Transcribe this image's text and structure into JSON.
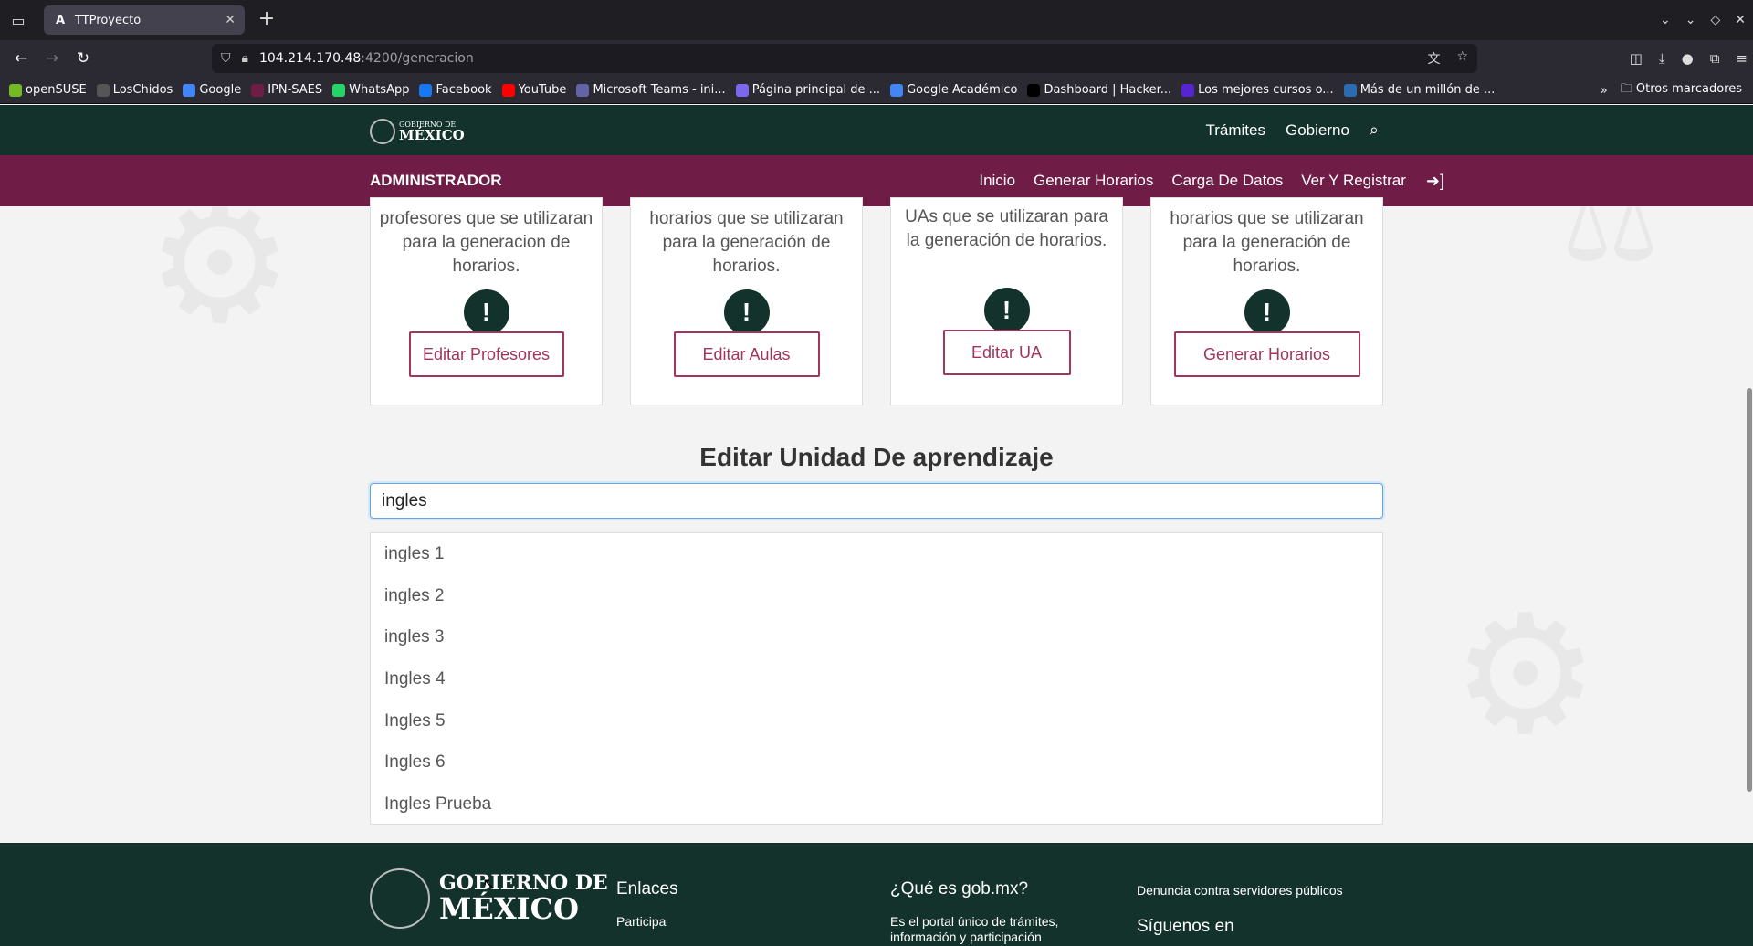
{
  "browser": {
    "tab_title": "TTProyecto",
    "tab_favicon": "A",
    "url_host": "104.214.170.48",
    "url_path": ":4200/generacion",
    "bookmarks": [
      {
        "label": "openSUSE",
        "color": "#73ba25"
      },
      {
        "label": "LosChidos",
        "color": "#555555"
      },
      {
        "label": "Google",
        "color": "#4285f4"
      },
      {
        "label": "IPN-SAES",
        "color": "#6f1d46"
      },
      {
        "label": "WhatsApp",
        "color": "#25d366"
      },
      {
        "label": "Facebook",
        "color": "#1877f2"
      },
      {
        "label": "YouTube",
        "color": "#ff0000"
      },
      {
        "label": "Microsoft Teams - ini...",
        "color": "#6264a7"
      },
      {
        "label": "Página principal de ...",
        "color": "#7b68ee"
      },
      {
        "label": "Google Académico",
        "color": "#4285f4"
      },
      {
        "label": "Dashboard | Hacker...",
        "color": "#000000"
      },
      {
        "label": "Los mejores cursos o...",
        "color": "#5624d0"
      },
      {
        "label": "Más de un millón de ...",
        "color": "#2b6cb0"
      }
    ],
    "other_bookmarks": "Otros marcadores"
  },
  "gob_header": {
    "logo_small": "GOBIERNO DE",
    "logo_big": "MÉXICO",
    "links": [
      "Trámites",
      "Gobierno"
    ]
  },
  "admin_bar": {
    "title": "ADMINISTRADOR",
    "nav": [
      "Inicio",
      "Generar Horarios",
      "Carga De Datos",
      "Ver Y Registrar"
    ]
  },
  "cards": [
    {
      "desc": "profesores que se utilizaran para la generacion de horarios.",
      "button": "Editar Profesores"
    },
    {
      "desc": "horarios que se utilizaran para la generación de horarios.",
      "button": "Editar Aulas"
    },
    {
      "desc": "UAs que se utilizaran para la generación de horarios.",
      "button": "Editar UA"
    },
    {
      "desc": "horarios que se utilizaran para la generación de horarios.",
      "button": "Generar Horarios"
    }
  ],
  "section": {
    "title": "Editar Unidad De aprendizaje",
    "search_value": "ingles",
    "results": [
      "ingles 1",
      "ingles 2",
      "ingles 3",
      "Ingles 4",
      "Ingles 5",
      "Ingles 6",
      "Ingles Prueba"
    ]
  },
  "footer": {
    "logo_top": "GOBIERNO DE",
    "logo_bottom": "MÉXICO",
    "enlaces_title": "Enlaces",
    "enlaces_first": "Participa",
    "que_es_title": "¿Qué es gob.mx?",
    "que_es_text": "Es el portal único de trámites, información y participación",
    "denuncia": "Denuncia contra servidores públicos",
    "siguenos": "Síguenos en"
  }
}
